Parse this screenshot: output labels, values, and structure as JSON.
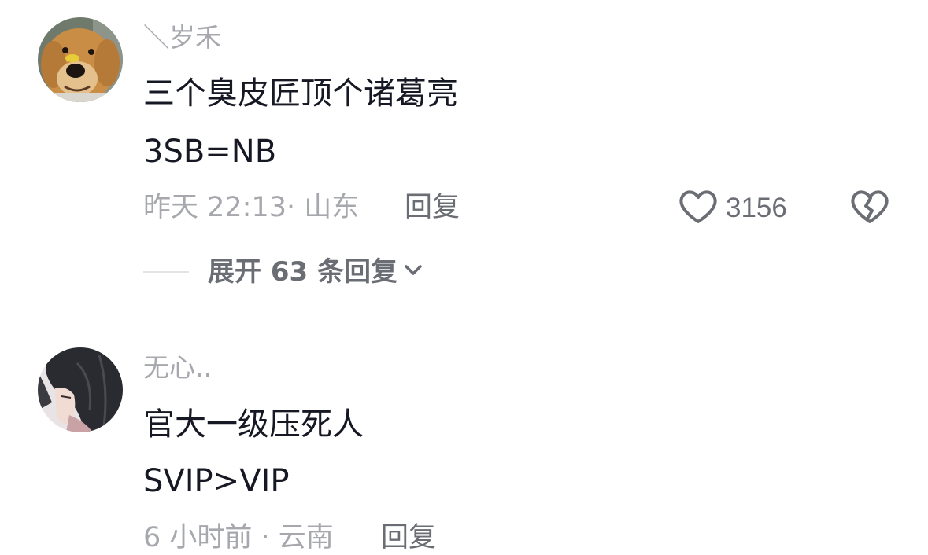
{
  "comments": [
    {
      "username": "＼岁禾",
      "text_lines": [
        "三个臭皮匠顶个诸葛亮",
        "3SB=NB"
      ],
      "time": "昨天 22:13",
      "location": "山东",
      "meta": "昨天 22:13· 山东",
      "reply_label": "回复",
      "like_count": "3156",
      "avatar_icon": "dog-avatar-icon",
      "expand_replies_label": "展开 63 条回复"
    },
    {
      "username": "无心..",
      "text_lines": [
        "官大一级压死人",
        "SVIP>VIP"
      ],
      "meta": "6 小时前 · 云南",
      "reply_label": "回复",
      "avatar_icon": "anime-avatar-icon"
    }
  ],
  "icons": {
    "like": "heart-outline-icon",
    "dislike": "broken-heart-icon",
    "expand": "chevron-down-icon"
  },
  "colors": {
    "primary_text": "#161823",
    "secondary_text": "#a6a8ad",
    "action_text": "#6b6d74",
    "divider": "#e3e4e6"
  }
}
